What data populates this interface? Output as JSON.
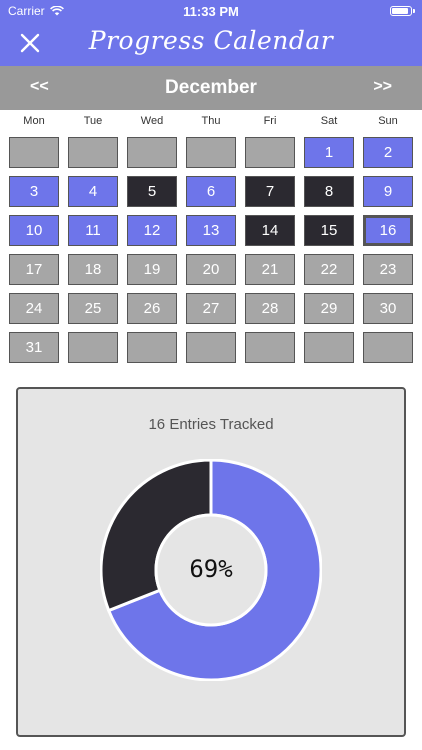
{
  "status_bar": {
    "carrier": "Carrier",
    "time": "11:33 PM"
  },
  "header": {
    "title": "Progress Calendar",
    "close_icon": "close-icon"
  },
  "calendar": {
    "month": "December",
    "prev_label": "<<",
    "next_label": ">>",
    "weekdays": [
      "Mon",
      "Tue",
      "Wed",
      "Thu",
      "Fri",
      "Sat",
      "Sun"
    ],
    "cells": [
      {
        "label": "",
        "state": "empty"
      },
      {
        "label": "",
        "state": "empty"
      },
      {
        "label": "",
        "state": "empty"
      },
      {
        "label": "",
        "state": "empty"
      },
      {
        "label": "",
        "state": "empty"
      },
      {
        "label": "1",
        "state": "done"
      },
      {
        "label": "2",
        "state": "done"
      },
      {
        "label": "3",
        "state": "done"
      },
      {
        "label": "4",
        "state": "done"
      },
      {
        "label": "5",
        "state": "missed"
      },
      {
        "label": "6",
        "state": "done"
      },
      {
        "label": "7",
        "state": "missed"
      },
      {
        "label": "8",
        "state": "missed"
      },
      {
        "label": "9",
        "state": "done"
      },
      {
        "label": "10",
        "state": "done"
      },
      {
        "label": "11",
        "state": "done"
      },
      {
        "label": "12",
        "state": "done"
      },
      {
        "label": "13",
        "state": "done"
      },
      {
        "label": "14",
        "state": "missed"
      },
      {
        "label": "15",
        "state": "missed"
      },
      {
        "label": "16",
        "state": "today"
      },
      {
        "label": "17",
        "state": "past"
      },
      {
        "label": "18",
        "state": "past"
      },
      {
        "label": "19",
        "state": "past"
      },
      {
        "label": "20",
        "state": "past"
      },
      {
        "label": "21",
        "state": "past"
      },
      {
        "label": "22",
        "state": "past"
      },
      {
        "label": "23",
        "state": "past"
      },
      {
        "label": "24",
        "state": "past"
      },
      {
        "label": "25",
        "state": "past"
      },
      {
        "label": "26",
        "state": "past"
      },
      {
        "label": "27",
        "state": "past"
      },
      {
        "label": "28",
        "state": "past"
      },
      {
        "label": "29",
        "state": "past"
      },
      {
        "label": "30",
        "state": "past"
      },
      {
        "label": "31",
        "state": "past"
      },
      {
        "label": "",
        "state": "empty"
      },
      {
        "label": "",
        "state": "empty"
      },
      {
        "label": "",
        "state": "empty"
      },
      {
        "label": "",
        "state": "empty"
      },
      {
        "label": "",
        "state": "empty"
      },
      {
        "label": "",
        "state": "empty"
      }
    ]
  },
  "summary": {
    "title": "16 Entries Tracked",
    "percent_label": "69%",
    "completed_fraction": 0.69,
    "colors": {
      "completed": "#6e75ea",
      "missed": "#2b2930",
      "accent": "#6e75ea"
    }
  }
}
